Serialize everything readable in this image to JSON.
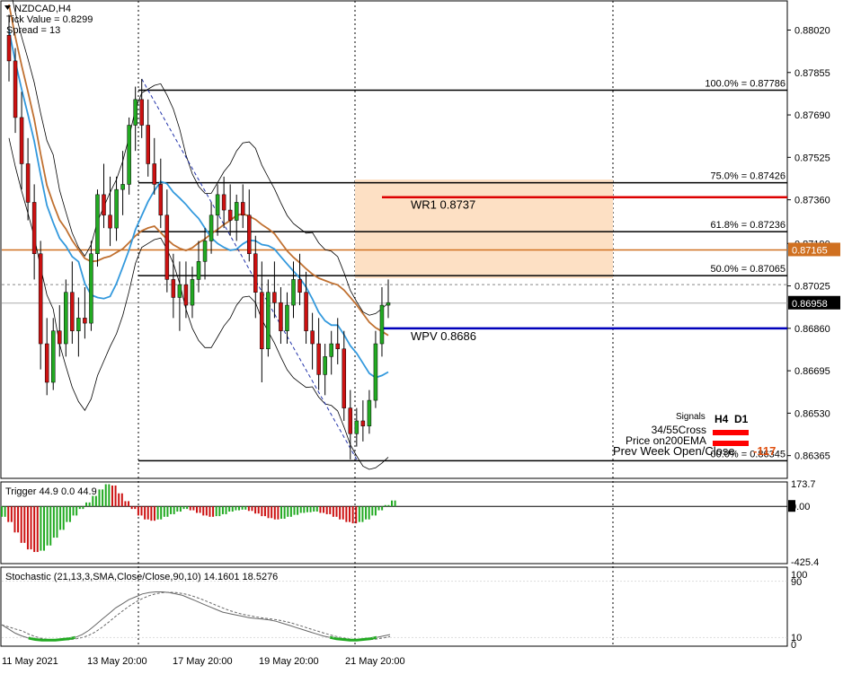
{
  "info": {
    "symbol": "NZDCAD,H4",
    "tick_value": "Tick Value = 0.8299",
    "spread": "Spread = 13"
  },
  "chart_data": {
    "type": "candlestick",
    "x_labels": [
      "11 May 2021",
      "13 May 20:00",
      "17 May 20:00",
      "19 May 20:00",
      "21 May 20:00"
    ],
    "price_axis": [
      "0.88020",
      "0.87855",
      "0.87690",
      "0.87525",
      "0.87360",
      "0.87190",
      "0.87025",
      "0.86860",
      "0.86695",
      "0.86530",
      "0.86365"
    ],
    "ylim": [
      0.8628,
      0.8813
    ],
    "current_price": "0.86958",
    "current_price_value": 0.86958,
    "ema_price": "0.87165",
    "ema_price_value": 0.87165,
    "fib_levels": [
      {
        "label": "100.0% = 0.87786",
        "value": 0.87786
      },
      {
        "label": "75.0% = 0.87426",
        "value": 0.87426
      },
      {
        "label": "61.8% = 0.87236",
        "value": 0.87236
      },
      {
        "label": "50.0% = 0.87065",
        "value": 0.87065
      },
      {
        "label": "00.0% = 0.86345",
        "value": 0.86345
      }
    ],
    "pivots": [
      {
        "label": "WR1",
        "value_text": "0.8737",
        "value": 0.8737,
        "color": "#dd0000"
      },
      {
        "label": "WPV",
        "value_text": "0.8686",
        "value": 0.8686,
        "color": "#0000bb"
      }
    ],
    "candles": [
      [
        0.88,
        0.8808,
        0.8782,
        0.879
      ],
      [
        0.879,
        0.8795,
        0.8762,
        0.8768
      ],
      [
        0.8768,
        0.8778,
        0.874,
        0.875
      ],
      [
        0.875,
        0.876,
        0.8728,
        0.8735
      ],
      [
        0.8735,
        0.8742,
        0.8705,
        0.8715
      ],
      [
        0.8715,
        0.872,
        0.867,
        0.868
      ],
      [
        0.868,
        0.869,
        0.866,
        0.8665
      ],
      [
        0.8665,
        0.869,
        0.8662,
        0.8685
      ],
      [
        0.8685,
        0.8695,
        0.8675,
        0.868
      ],
      [
        0.868,
        0.8705,
        0.8675,
        0.87
      ],
      [
        0.87,
        0.8712,
        0.868,
        0.8685
      ],
      [
        0.8685,
        0.8698,
        0.8675,
        0.869
      ],
      [
        0.869,
        0.8702,
        0.8682,
        0.8688
      ],
      [
        0.8688,
        0.872,
        0.8685,
        0.8715
      ],
      [
        0.8715,
        0.874,
        0.871,
        0.8738
      ],
      [
        0.8738,
        0.875,
        0.8725,
        0.873
      ],
      [
        0.873,
        0.8745,
        0.8718,
        0.8725
      ],
      [
        0.8725,
        0.8745,
        0.872,
        0.874
      ],
      [
        0.874,
        0.8755,
        0.873,
        0.8742
      ],
      [
        0.8742,
        0.8768,
        0.8738,
        0.8765
      ],
      [
        0.8765,
        0.878,
        0.8755,
        0.8775
      ],
      [
        0.8775,
        0.8783,
        0.876,
        0.8765
      ],
      [
        0.8765,
        0.8775,
        0.8745,
        0.875
      ],
      [
        0.875,
        0.876,
        0.8738,
        0.8742
      ],
      [
        0.8742,
        0.8752,
        0.8725,
        0.873
      ],
      [
        0.873,
        0.874,
        0.87,
        0.8705
      ],
      [
        0.8705,
        0.8715,
        0.869,
        0.8698
      ],
      [
        0.8698,
        0.8712,
        0.8685,
        0.8703
      ],
      [
        0.8703,
        0.8712,
        0.869,
        0.8695
      ],
      [
        0.8695,
        0.871,
        0.869,
        0.8705
      ],
      [
        0.8705,
        0.872,
        0.87,
        0.8712
      ],
      [
        0.8712,
        0.8725,
        0.8705,
        0.872
      ],
      [
        0.872,
        0.8735,
        0.8715,
        0.873
      ],
      [
        0.873,
        0.8742,
        0.8722,
        0.8738
      ],
      [
        0.8738,
        0.8745,
        0.8725,
        0.8732
      ],
      [
        0.8732,
        0.8742,
        0.8722,
        0.8728
      ],
      [
        0.8728,
        0.8738,
        0.872,
        0.8735
      ],
      [
        0.8735,
        0.8742,
        0.8725,
        0.873
      ],
      [
        0.873,
        0.874,
        0.8712,
        0.8715
      ],
      [
        0.8715,
        0.8722,
        0.869,
        0.87
      ],
      [
        0.87,
        0.8712,
        0.8665,
        0.8678
      ],
      [
        0.8678,
        0.8705,
        0.8675,
        0.87
      ],
      [
        0.87,
        0.8712,
        0.869,
        0.8696
      ],
      [
        0.8696,
        0.8702,
        0.868,
        0.8685
      ],
      [
        0.8685,
        0.87,
        0.868,
        0.8695
      ],
      [
        0.8695,
        0.8712,
        0.869,
        0.8705
      ],
      [
        0.8705,
        0.8715,
        0.8695,
        0.87
      ],
      [
        0.87,
        0.8708,
        0.868,
        0.8685
      ],
      [
        0.8685,
        0.8692,
        0.867,
        0.868
      ],
      [
        0.868,
        0.869,
        0.8662,
        0.8668
      ],
      [
        0.8668,
        0.868,
        0.866,
        0.8675
      ],
      [
        0.8675,
        0.8685,
        0.8668,
        0.868
      ],
      [
        0.868,
        0.869,
        0.8672,
        0.8678
      ],
      [
        0.8678,
        0.8685,
        0.865,
        0.8655
      ],
      [
        0.8655,
        0.8662,
        0.8635,
        0.8645
      ],
      [
        0.8645,
        0.8655,
        0.864,
        0.865
      ],
      [
        0.865,
        0.8658,
        0.8642,
        0.8648
      ],
      [
        0.8648,
        0.8662,
        0.8645,
        0.8658
      ],
      [
        0.8658,
        0.8685,
        0.8655,
        0.868
      ],
      [
        0.868,
        0.8702,
        0.8675,
        0.8695
      ],
      [
        0.8695,
        0.8705,
        0.869,
        0.8696
      ]
    ],
    "signals": {
      "title": "Signals",
      "cols": [
        "H4",
        "D1"
      ],
      "rows": [
        "34/55Cross",
        "Price on200EMA",
        "Prev Week Open/Close"
      ],
      "value": "-117"
    },
    "trigger": {
      "label": "Trigger 44.9 0.0 44.9",
      "axis": [
        "173.7",
        "0.00",
        "-425.4"
      ],
      "ylim": [
        -425.4,
        173.7
      ],
      "values": [
        -80,
        -120,
        -200,
        -280,
        -330,
        -350,
        -340,
        -300,
        -240,
        -180,
        -120,
        -70,
        -20,
        30,
        80,
        130,
        170,
        160,
        100,
        40,
        -20,
        -70,
        -100,
        -110,
        -100,
        -80,
        -60,
        -40,
        -20,
        -30,
        -50,
        -70,
        -80,
        -75,
        -60,
        -40,
        -30,
        -25,
        -35,
        -55,
        -75,
        -90,
        -100,
        -95,
        -80,
        -65,
        -50,
        -45,
        -40,
        -50,
        -60,
        -80,
        -100,
        -120,
        -130,
        -120,
        -100,
        -70,
        -30,
        10,
        45
      ]
    },
    "stochastic": {
      "label": "Stochastic (21,13,3,SMA,Close/Close,90,10) 14.1601 18.5276",
      "axis": [
        "100",
        "90",
        "10",
        "0"
      ],
      "ylim": [
        0,
        100
      ],
      "main": [
        28,
        22,
        16,
        12,
        9,
        7,
        6,
        6,
        6,
        7,
        8,
        10,
        14,
        20,
        28,
        36,
        44,
        52,
        58,
        64,
        68,
        72,
        74,
        75,
        75,
        74,
        72,
        70,
        66,
        62,
        58,
        54,
        50,
        46,
        44,
        42,
        40,
        38,
        37,
        36,
        35,
        33,
        30,
        27,
        24,
        21,
        18,
        15,
        12,
        10,
        8,
        7,
        6,
        6,
        7,
        8,
        10,
        12,
        14
      ]
    }
  }
}
